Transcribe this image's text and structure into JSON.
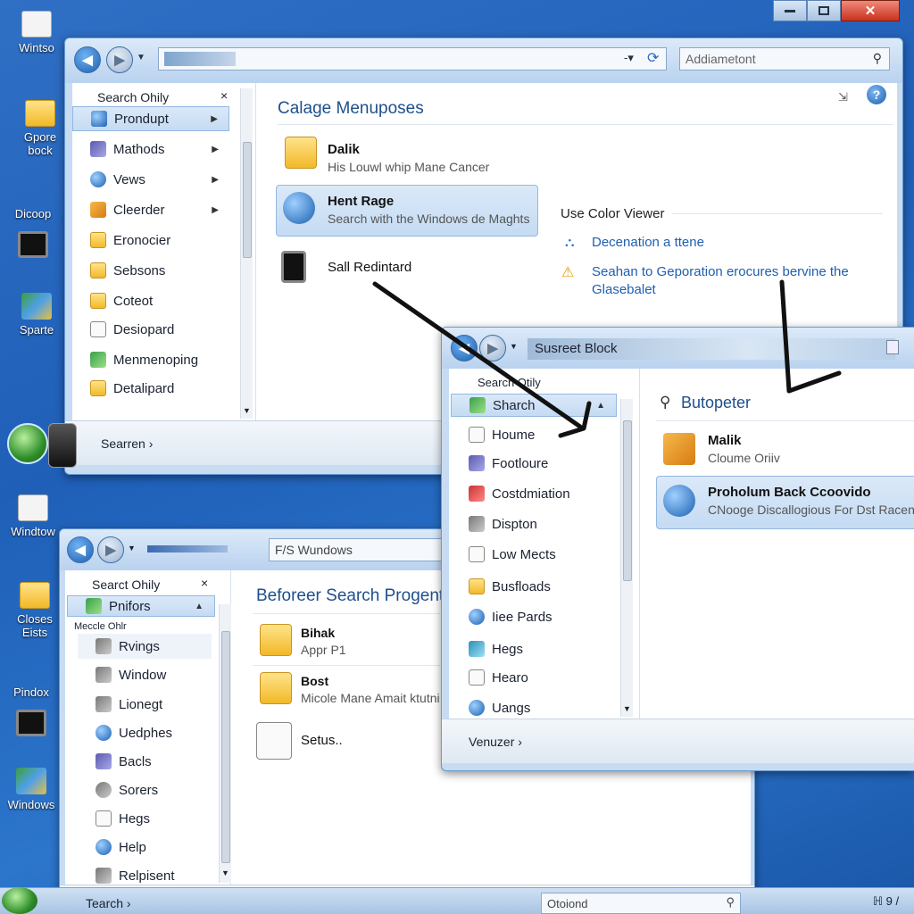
{
  "desktop": {
    "icons": [
      {
        "label": "Wintso"
      },
      {
        "label": "Gpore bock"
      },
      {
        "label": "Dicoop"
      },
      {
        "label": "Sparte"
      },
      {
        "label": "Windtow"
      },
      {
        "label": "Closes Eists"
      },
      {
        "label": "Pindox"
      },
      {
        "label": "Windows"
      }
    ]
  },
  "window_top": {
    "search_placeholder": "Addiametont",
    "sidebar": {
      "header": "Search Ohily",
      "items": [
        {
          "label": "Prondupt",
          "icon": "folder-icon",
          "color": "#4a90d9"
        },
        {
          "label": "Mathods",
          "icon": "gear-icon",
          "color": "#5a6bb0"
        },
        {
          "label": "Vews",
          "icon": "globe-icon",
          "color": "#2a7fd0"
        },
        {
          "label": "Cleerder",
          "icon": "pencil-icon",
          "color": "#7a5030"
        },
        {
          "label": "Eronocier",
          "icon": "folder-icon",
          "color": "#e8b030"
        },
        {
          "label": "Sebsons",
          "icon": "folder-icon",
          "color": "#e8b030"
        },
        {
          "label": "Coteot",
          "icon": "folder-icon",
          "color": "#e8b030"
        },
        {
          "label": "Desiopard",
          "icon": "document-icon",
          "color": "#888888"
        },
        {
          "label": "Menmenoping",
          "icon": "network-icon",
          "color": "#3a8a4a"
        },
        {
          "label": "Detalipard",
          "icon": "folder-icon",
          "color": "#e8b030"
        }
      ]
    },
    "main": {
      "heading": "Calage Menuposes",
      "items": [
        {
          "title": "Dalik",
          "subtitle": "His Louwl whip Mane Cancer"
        },
        {
          "title": "Hent Rage",
          "subtitle": "Search with the Windows de Maghts"
        },
        {
          "title": "Sall Redintard",
          "subtitle": ""
        }
      ],
      "side_heading": "Use Color Viewer",
      "links": [
        {
          "text": "Decenation a ttene"
        },
        {
          "text": "Seahan to Geporation erocures bervine the Glasebalet"
        }
      ]
    },
    "footer": {
      "label": "Searren ›"
    }
  },
  "window_bottom": {
    "address": "F/S  Wundows",
    "sidebar": {
      "header": "Searct Ohily",
      "selected": "Pnifors",
      "subheader": "Meccle Ohlr",
      "items": [
        {
          "label": "Rvings"
        },
        {
          "label": "Window"
        },
        {
          "label": "Lionegt"
        },
        {
          "label": "Uedphes"
        },
        {
          "label": "Bacls"
        },
        {
          "label": "Sorers"
        },
        {
          "label": "Hegs"
        },
        {
          "label": "Help"
        },
        {
          "label": "Relpisent"
        }
      ]
    },
    "main": {
      "heading": "Beforeer Search Progentes",
      "items": [
        {
          "title": "Bihak",
          "subtitle": "Appr P1"
        },
        {
          "title": "Bost",
          "subtitle": "Micole Mane Amait ktutni"
        },
        {
          "title": "Setus..",
          "subtitle": ""
        }
      ]
    },
    "footer": {
      "label": "Tearch ›"
    },
    "search_box": "Otoiond"
  },
  "window_overlay": {
    "title": "Susreet Block",
    "sidebar": {
      "header": "Searcn Otily",
      "items": [
        {
          "label": "Sharch"
        },
        {
          "label": "Houme"
        },
        {
          "label": "Footloure"
        },
        {
          "label": "Costdmiation"
        },
        {
          "label": "Dispton"
        },
        {
          "label": "Low Mects"
        },
        {
          "label": "Busfloads"
        },
        {
          "label": "Iiee Pards"
        },
        {
          "label": "Hegs"
        },
        {
          "label": "Hearo"
        },
        {
          "label": "Uangs"
        }
      ]
    },
    "main": {
      "heading": "Butopeter",
      "items": [
        {
          "title": "Malik",
          "subtitle": "Cloume Oriiv"
        },
        {
          "title": "Proholum Back Ccoovido",
          "subtitle": "CNooge Discallogious For Dst Racent"
        }
      ]
    },
    "footer": {
      "label": "Venuzer ›"
    }
  },
  "taskbar": {
    "tray_text": "ℍ  9 /"
  }
}
